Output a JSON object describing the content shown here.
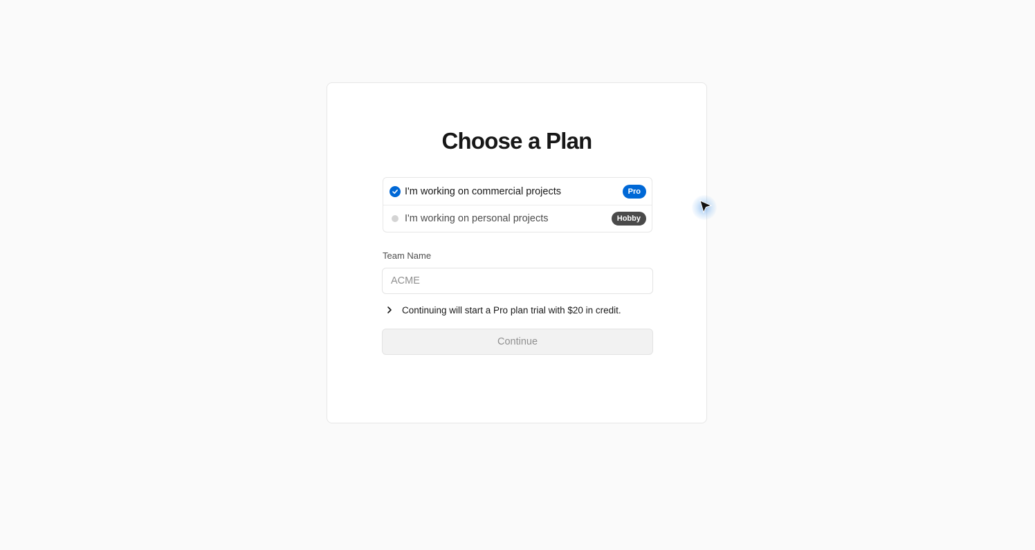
{
  "page": {
    "title": "Choose a Plan"
  },
  "plans": [
    {
      "label": "I'm working on commercial projects",
      "badge": "Pro",
      "selected": true,
      "badge_color": "#0068d6"
    },
    {
      "label": "I'm working on personal projects",
      "badge": "Hobby",
      "selected": false,
      "badge_color": "#4a4a4a"
    }
  ],
  "team_name": {
    "label": "Team Name",
    "placeholder": "ACME",
    "value": ""
  },
  "disclosure": {
    "icon": "chevron-right-icon",
    "text": "Continuing will start a Pro plan trial with $20 in credit."
  },
  "continue_button": {
    "label": "Continue",
    "disabled": true
  },
  "colors": {
    "accent": "#0068d6",
    "background": "#fafafa"
  }
}
